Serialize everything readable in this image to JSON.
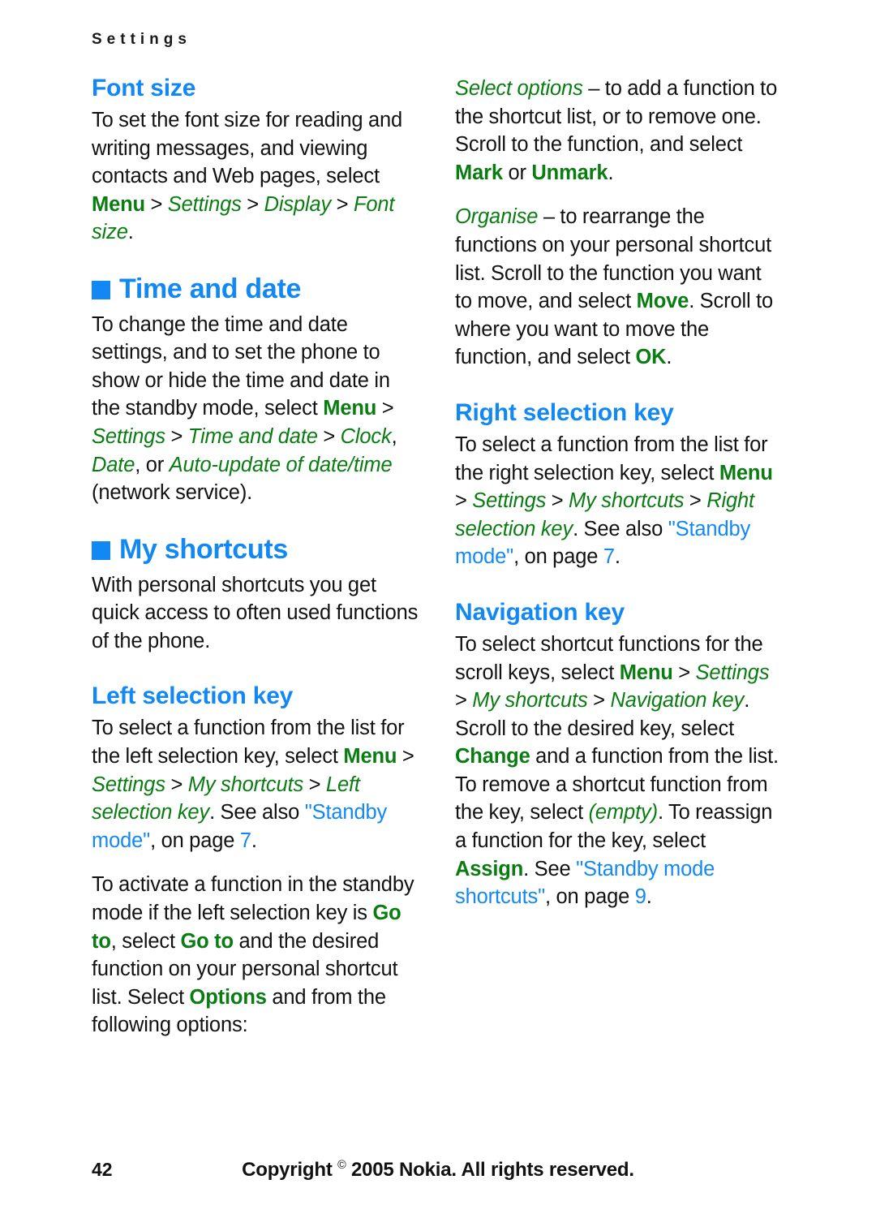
{
  "header": {
    "running_head": "Settings"
  },
  "colors": {
    "heading_blue": "#1288f5",
    "ui_green": "#0a7d12",
    "link_blue": "#1288f5",
    "body_text": "#121212"
  },
  "left_column": {
    "font_size_heading": "Font size",
    "font_size_para": {
      "t1": "To set the font size for reading and writing messages, and viewing contacts and Web pages, select ",
      "menu": "Menu",
      "sep1": " > ",
      "settings": "Settings",
      "sep2": " > ",
      "display": "Display",
      "sep3": " > ",
      "fontsize": "Font size",
      "end": "."
    },
    "time_and_date_heading": "Time and date",
    "time_and_date_para": {
      "t1": "To change the time and date settings, and to set the phone to show or hide the time and date in the standby mode, select ",
      "menu": "Menu",
      "sep1": " > ",
      "settings": "Settings",
      "sep2": " > ",
      "timeanddate": "Time and date",
      "sep3": " > ",
      "clock": "Clock",
      "comma1": ", ",
      "date": "Date",
      "or": ", or ",
      "autoupdate": "Auto-update of date/time",
      "end": " (network service)."
    },
    "my_shortcuts_heading": "My shortcuts",
    "my_shortcuts_para": "With personal shortcuts you get quick access to often used functions of the phone.",
    "left_selection_key_heading": "Left selection key",
    "left_selection_key_para": {
      "t1": "To select a function from the list for the left selection key, select ",
      "menu": "Menu",
      "sep1": " > ",
      "settings": "Settings",
      "sep2": " > ",
      "myshortcuts": "My shortcuts",
      "sep3": " > ",
      "leftselkey": "Left selection key",
      "t2": ". See also ",
      "link": "\"Standby mode\"",
      "t3": ", on page ",
      "page": "7",
      "end": "."
    },
    "left_selection_key_para2": {
      "t1": "To activate a function in the standby mode if the left selection key is ",
      "goto1": "Go to",
      "t2": ", select ",
      "goto2": "Go to",
      "t3": " and the desired function on your personal shortcut list. Select ",
      "options": "Options",
      "t4": " and from the following options:"
    }
  },
  "right_column": {
    "select_options_para": {
      "term": "Select options",
      "t1": " – to add a function to the shortcut list, or to remove one. Scroll to the function, and select ",
      "mark": "Mark",
      "t2": " or ",
      "unmark": "Unmark",
      "end": "."
    },
    "organise_para": {
      "term": "Organise",
      "t1": " – to rearrange the functions on your personal shortcut list. Scroll to the function you want to move, and select ",
      "move": "Move",
      "t2": ". Scroll to where you want to move the function, and select ",
      "ok": "OK",
      "end": "."
    },
    "right_selection_key_heading": "Right selection key",
    "right_selection_key_para": {
      "t1": "To select a function from the list for the right selection key, select ",
      "menu": "Menu",
      "sep1": " > ",
      "settings": "Settings",
      "sep2": " > ",
      "myshortcuts": "My shortcuts",
      "sep3": " > ",
      "rightselkey": "Right selection key",
      "t2": ". See also ",
      "link": "\"Standby mode\"",
      "t3": ", on page ",
      "page": "7",
      "end": "."
    },
    "navigation_key_heading": "Navigation key",
    "navigation_key_para": {
      "t1": "To select shortcut functions for the scroll keys, select ",
      "menu": "Menu",
      "sep1": " > ",
      "settings": "Settings",
      "sep2": " > ",
      "myshortcuts": "My shortcuts",
      "sep3": " > ",
      "navkey": "Navigation key",
      "t2": ". Scroll to the desired key, select ",
      "change": "Change",
      "t3": " and a function from the list. To remove a shortcut function from the key, select ",
      "empty": "(empty)",
      "t4": ". To reassign a function for the key, select ",
      "assign": "Assign",
      "t5": ". See ",
      "link": "\"Standby mode shortcuts\"",
      "t6": ", on page ",
      "page": "9",
      "end": "."
    }
  },
  "footer": {
    "page_number": "42",
    "copyright_pre": "Copyright ",
    "copyright_symbol": "©",
    "copyright_post": " 2005 Nokia. All rights reserved."
  }
}
